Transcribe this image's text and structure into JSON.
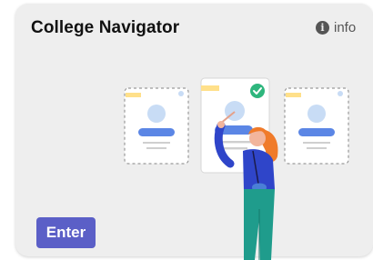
{
  "card": {
    "title": "College Navigator",
    "info_label": "info",
    "info_icon": "info-circle-icon",
    "enter_label": "Enter"
  },
  "colors": {
    "card_bg": "#eeeeee",
    "accent_button": "#5b5fc7",
    "illustration_blue": "#5b86e5",
    "illustration_light_blue": "#c8dcf5",
    "illustration_yellow": "#ffe08a",
    "check_green": "#2eb67d",
    "hair_orange": "#f07b2a",
    "shirt_blue": "#2f45c9",
    "pants_green": "#1f9c8c"
  }
}
